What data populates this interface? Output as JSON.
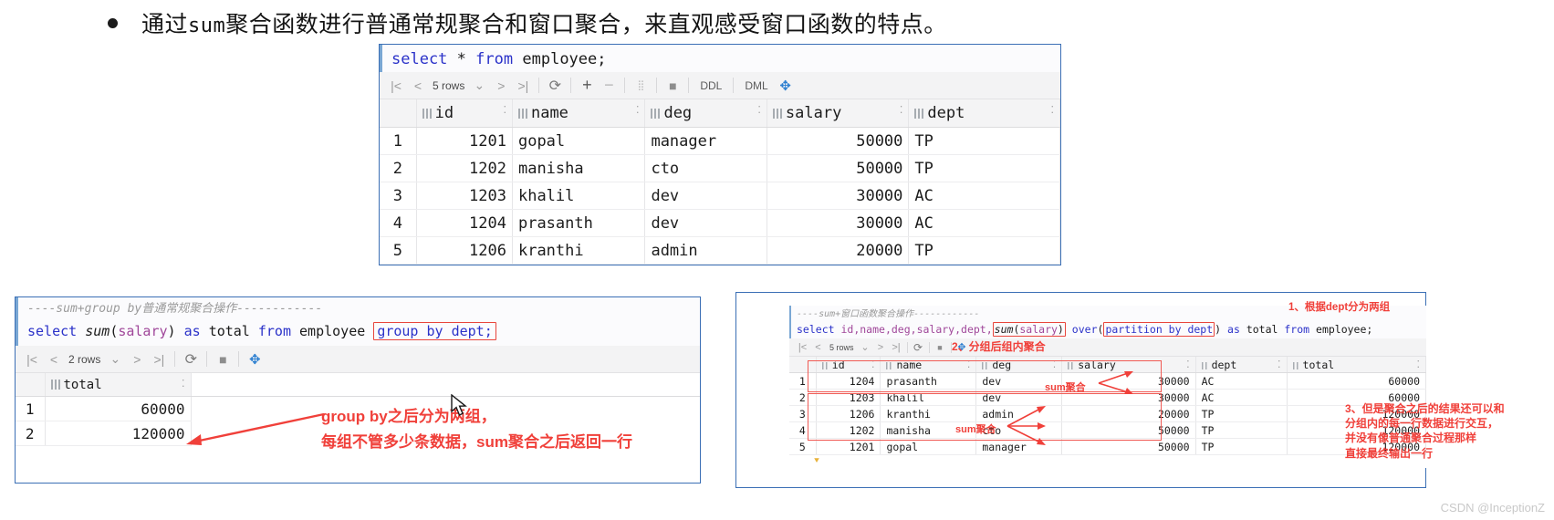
{
  "headline": {
    "bullet": "•",
    "text_before": "通过",
    "mono_word": "sum",
    "text_after": "聚合函数进行普通常规聚合和窗口聚合，来直观感受窗口函数的特点。"
  },
  "top_panel": {
    "sql": {
      "k1": "select",
      "star": "*",
      "k2": "from",
      "table": "employee;"
    },
    "toolbar": {
      "first_icon": "first-page-icon",
      "prev_icon": "previous-page-icon",
      "rows_label": "5 rows",
      "rows_caret": "⌄",
      "next_icon": "next-page-icon",
      "last_icon": "last-page-icon",
      "refresh_icon": "refresh-icon",
      "add_icon": "add-row-icon",
      "remove_icon": "remove-row-icon",
      "db_icon": "database-icon",
      "stop_icon": "stop-icon",
      "ddl_label": "DDL",
      "dml_label": "DML",
      "magic_icon": "magic-wand-icon"
    },
    "columns": [
      "id",
      "name",
      "deg",
      "salary",
      "dept"
    ],
    "rows": [
      {
        "n": "1",
        "id": "1201",
        "name": "gopal",
        "deg": "manager",
        "salary": "50000",
        "dept": "TP"
      },
      {
        "n": "2",
        "id": "1202",
        "name": "manisha",
        "deg": "cto",
        "salary": "50000",
        "dept": "TP"
      },
      {
        "n": "3",
        "id": "1203",
        "name": "khalil",
        "deg": "dev",
        "salary": "30000",
        "dept": "AC"
      },
      {
        "n": "4",
        "id": "1204",
        "name": "prasanth",
        "deg": "dev",
        "salary": "30000",
        "dept": "AC"
      },
      {
        "n": "5",
        "id": "1206",
        "name": "kranthi",
        "deg": "admin",
        "salary": "20000",
        "dept": "TP"
      }
    ]
  },
  "left_panel": {
    "comment": "----sum+group by普通常规聚合操作------------",
    "sql": {
      "k_select": "select",
      "fn_sum": "sum",
      "p_open": "(",
      "col_salary": "salary",
      "p_close": ")",
      "k_as": "as",
      "alias_total": "total",
      "k_from": "from",
      "table": "employee",
      "highlight": "group by dept;"
    },
    "toolbar": {
      "first_icon": "first-page-icon",
      "prev_icon": "previous-page-icon",
      "rows_label": "2 rows",
      "rows_caret": "⌄",
      "next_icon": "next-page-icon",
      "last_icon": "last-page-icon",
      "refresh_icon": "refresh-icon",
      "stop_icon": "stop-icon",
      "magic_icon": "magic-wand-icon"
    },
    "columns": [
      "total"
    ],
    "rows": [
      {
        "n": "1",
        "total": "60000"
      },
      {
        "n": "2",
        "total": "120000"
      }
    ],
    "annotation": {
      "line1": "group by之后分为两组，",
      "line2": "每组不管多少条数据，sum聚合之后返回一行"
    }
  },
  "right_panel": {
    "comment": "----sum+窗口函数聚合操作------------",
    "sql": {
      "k_select": "select",
      "cols": "id,name,deg,salary,dept,",
      "fn_sum": "sum",
      "p_open": "(",
      "col_salary": "salary",
      "p_close": ")",
      "k_over": "over",
      "over_open": "(",
      "partition": "partition by dept",
      "over_close": ")",
      "k_as": "as",
      "alias_total": "total",
      "k_from": "from",
      "table": "employee;"
    },
    "toolbar": {
      "first_icon": "first-page-icon",
      "prev_icon": "previous-page-icon",
      "rows_label": "5 rows",
      "rows_caret": "⌄",
      "next_icon": "next-page-icon",
      "last_icon": "last-page-icon",
      "refresh_icon": "refresh-icon",
      "stop_icon": "stop-icon",
      "magic_icon": "magic-wand-icon"
    },
    "columns": [
      "id",
      "name",
      "deg",
      "salary",
      "dept",
      "total"
    ],
    "rows": [
      {
        "n": "1",
        "id": "1204",
        "name": "prasanth",
        "deg": "dev",
        "salary": "30000",
        "dept": "AC",
        "total": "60000"
      },
      {
        "n": "2",
        "id": "1203",
        "name": "khalil",
        "deg": "dev",
        "salary": "30000",
        "dept": "AC",
        "total": "60000"
      },
      {
        "n": "3",
        "id": "1206",
        "name": "kranthi",
        "deg": "admin",
        "salary": "20000",
        "dept": "TP",
        "total": "120000"
      },
      {
        "n": "4",
        "id": "1202",
        "name": "manisha",
        "deg": "cto",
        "salary": "50000",
        "dept": "TP",
        "total": "120000"
      },
      {
        "n": "5",
        "id": "1201",
        "name": "gopal",
        "deg": "manager",
        "salary": "50000",
        "dept": "TP",
        "total": "120000"
      }
    ],
    "annotations": {
      "note1": "1、根据dept分为两组",
      "note2": "2、分组后组内聚合",
      "sum_label_1": "sum聚合",
      "sum_label_2": "sum聚合",
      "note3_line1": "3、但是聚合之后的结果还可以和",
      "note3_line2": "分组内的每一行数据进行交互，",
      "note3_line3": "并没有像普通聚合过程那样",
      "note3_line4": "直接最终输出一行"
    }
  },
  "watermark": "CSDN @InceptionZ",
  "colors": {
    "accent_blue": "#3b6fb5",
    "keyword_blue": "#2b32c9",
    "column_pink": "#a0479a",
    "annotation_red": "#f0403a",
    "comment_gray": "#9a9a9a"
  }
}
